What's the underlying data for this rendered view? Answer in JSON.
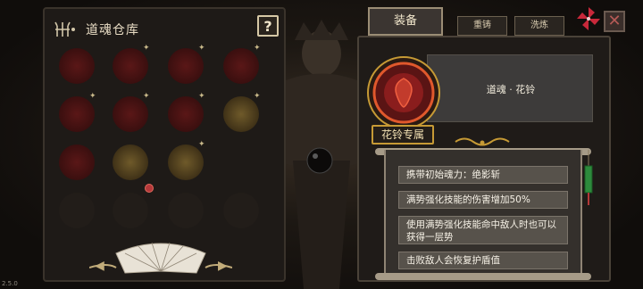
{
  "version": "2.5.0",
  "warehouse": {
    "title": "道魂仓库",
    "help_label": "?"
  },
  "tabs": {
    "active": "装备",
    "recast": "重铸",
    "wash": "洗炼"
  },
  "close_label": "✕",
  "item": {
    "name": "道魂 · 花铃",
    "exclusive_label": "花铃专属",
    "effects": [
      "携带初始魂力：绝影斩",
      "满势强化技能的伤害增加50%",
      "使用满势强化技能命中敌人时也可以获得一层势",
      "击败敌人会恢复护盾值"
    ]
  },
  "colors": {
    "accent_gold": "#c69a35",
    "slot_red": "#7a1e1e",
    "slot_gold": "#6f5a2a",
    "warning_red": "#b4383a"
  },
  "icons": [
    "menu-trident-icon",
    "pinwheel-icon",
    "close-icon",
    "folding-fan-icon",
    "arrow-left-icon",
    "arrow-right-icon"
  ]
}
